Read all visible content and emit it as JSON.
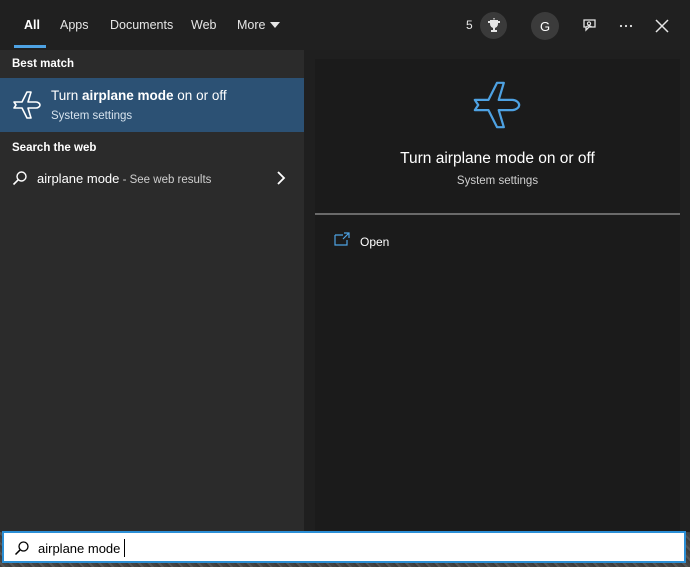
{
  "tabs": [
    {
      "label": "All",
      "active": true
    },
    {
      "label": "Apps"
    },
    {
      "label": "Documents"
    },
    {
      "label": "Web"
    },
    {
      "label": "More"
    }
  ],
  "header": {
    "rewards_count": "5",
    "avatar_initial": "G",
    "icons": [
      "trophy-icon",
      "feedback-icon",
      "more-options-icon",
      "close-icon"
    ]
  },
  "left": {
    "best_match_heading": "Best match",
    "best_match": {
      "title_prefix": "Turn ",
      "title_bold": "airplane mode",
      "title_suffix": " on or off",
      "subtitle": "System settings",
      "icon": "airplane-icon"
    },
    "web_heading": "Search the web",
    "web_result": {
      "query": "airplane mode",
      "suffix": " - See web results",
      "icon": "search-icon"
    }
  },
  "preview": {
    "title": "Turn airplane mode on or off",
    "subtitle": "System settings",
    "actions": [
      {
        "label": "Open",
        "icon": "open-external-icon"
      }
    ]
  },
  "search": {
    "value": "airplane mode"
  },
  "colors": {
    "accent": "#4ea2e3",
    "selection": "#2c5174",
    "search_border": "#2b8fd6"
  }
}
